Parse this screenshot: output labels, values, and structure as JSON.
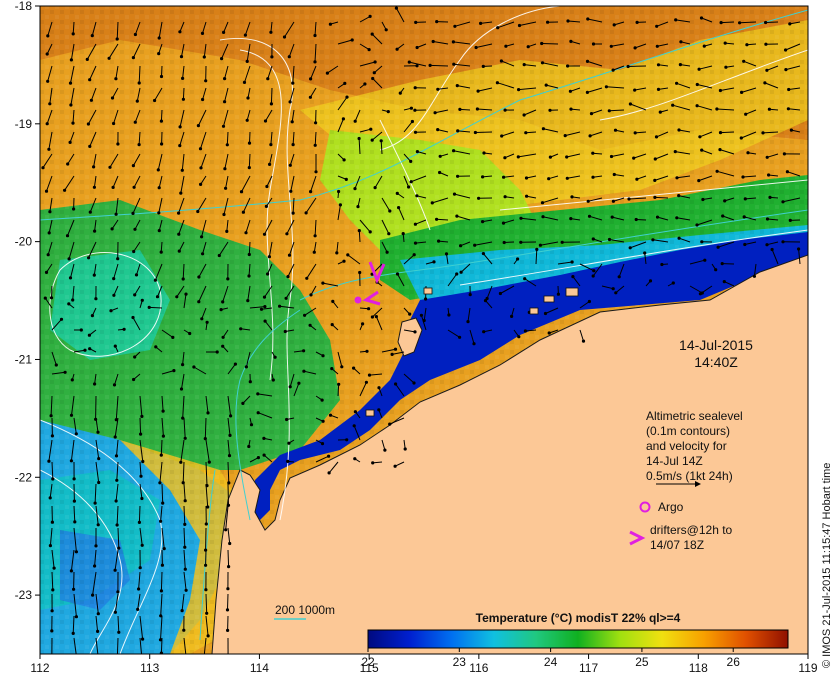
{
  "map": {
    "lon_ticks": [
      "112",
      "113",
      "114",
      "115",
      "116",
      "117",
      "118",
      "119"
    ],
    "lat_ticks": [
      "-18",
      "-19",
      "-20",
      "-21",
      "-22",
      "-23"
    ],
    "lon_range": [
      112,
      119
    ],
    "lat_range": [
      -18,
      -23.5
    ]
  },
  "date": {
    "day": "14-Jul-2015",
    "time": "14:40Z"
  },
  "legend": {
    "line1": "Altimetric sealevel",
    "line2": "(0.1m contours)",
    "line3": "and velocity for",
    "line4": "14-Jul 14Z",
    "line5": "0.5m/s (1kt 24h)",
    "argo_label": "Argo",
    "drifters_line1": "drifters@12h to",
    "drifters_line2": "14/07 18Z"
  },
  "bathymetry": {
    "label": "200  1000m"
  },
  "colorbar": {
    "title": "Temperature (°C) modisT 22% ql>=4",
    "ticks": [
      "22",
      "23",
      "24",
      "25",
      "26"
    ],
    "range": [
      22,
      26.6
    ]
  },
  "credit": "© IMOS 21-Jul-2015 11:15:47 Hobart time",
  "colors": {
    "land": "#fcc896",
    "argo": "#e020e0",
    "drifter": "#e020e0",
    "bathy": "#40d0d0"
  }
}
